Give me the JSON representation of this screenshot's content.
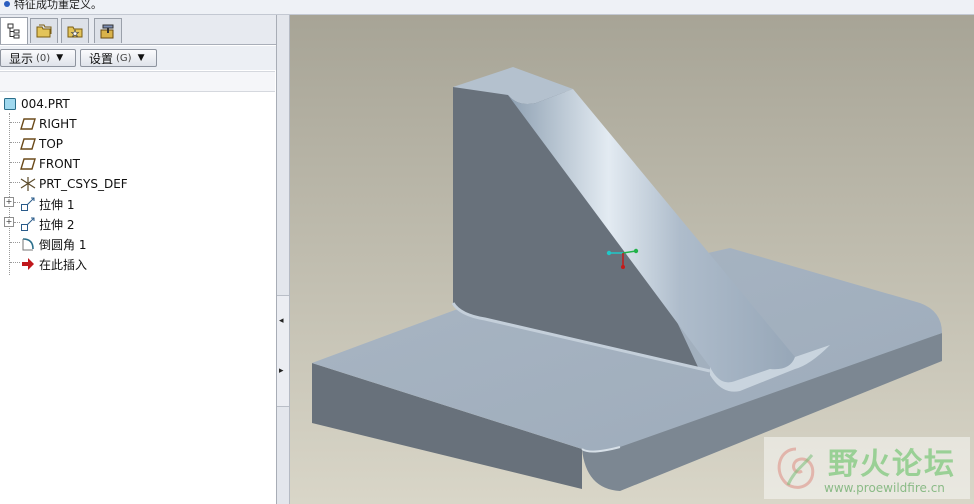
{
  "message": {
    "text": "特征成功重定义。"
  },
  "toolbar": {
    "show_label": "显示",
    "show_key": "(0)",
    "settings_label": "设置",
    "settings_key": "(G)"
  },
  "tree": {
    "root": "004.PRT",
    "items": [
      {
        "label": "RIGHT",
        "icon": "datum-plane-icon"
      },
      {
        "label": "TOP",
        "icon": "datum-plane-icon"
      },
      {
        "label": "FRONT",
        "icon": "datum-plane-icon"
      },
      {
        "label": "PRT_CSYS_DEF",
        "icon": "csys-icon"
      },
      {
        "label": "拉伸 1",
        "icon": "extrude-icon"
      },
      {
        "label": "拉伸 2",
        "icon": "extrude-icon"
      },
      {
        "label": "倒圆角 1",
        "icon": "round-icon"
      },
      {
        "label": "在此插入",
        "icon": "insert-here-arrow-icon"
      }
    ]
  },
  "watermark": {
    "title": "野火论坛",
    "url": "www.proewildfire.cn"
  },
  "colors": {
    "accent": "#2a5dbf",
    "viewport_top": "#a7a496",
    "viewport_bottom": "#d9d6c8",
    "model": "#a3b1c0"
  }
}
